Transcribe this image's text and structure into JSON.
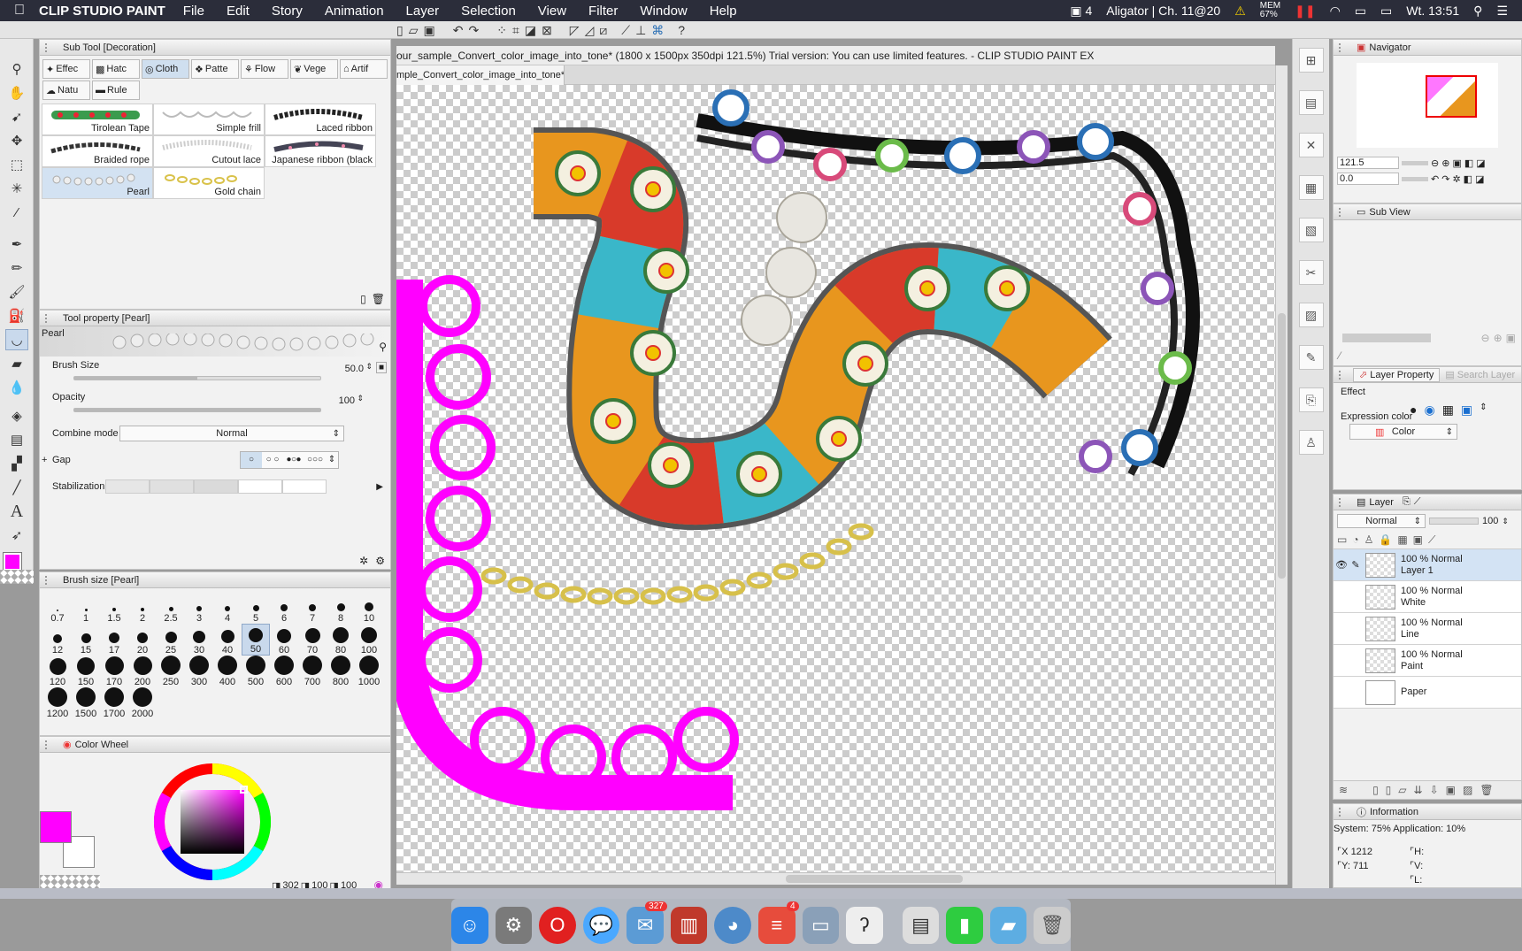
{
  "menubar": {
    "app": "CLIP STUDIO PAINT",
    "items": [
      "File",
      "Edit",
      "Story",
      "Animation",
      "Layer",
      "Selection",
      "View",
      "Filter",
      "Window",
      "Help"
    ],
    "status": {
      "desktop": "4",
      "project": "Aligator | Ch. 11@20",
      "mem": "MEM\n67%",
      "clock": "Wt. 13:51"
    }
  },
  "doc": {
    "title": "our_sample_Convert_color_image_into_tone* (1800 x 1500px 350dpi 121.5%)  Trial version: You can use limited features. - CLIP STUDIO PAINT EX",
    "tab": "mple_Convert_color_image_into_tone*"
  },
  "subtool": {
    "title": "Sub Tool [Decoration]",
    "tabs": [
      "Effec",
      "Hatc",
      "Cloth",
      "Patte",
      "Flow",
      "Vege",
      "Artif",
      "Natu",
      "Rule"
    ],
    "materials": [
      "Tirolean Tape",
      "Simple frill",
      "Laced ribbon",
      "Braided rope",
      "Cutout lace",
      "Japanese ribbon (black",
      "Pearl",
      "Gold chain"
    ]
  },
  "toolprop": {
    "title": "Tool property [Pearl]",
    "name": "Pearl",
    "brush_size_label": "Brush Size",
    "brush_size": "50.0",
    "opacity_label": "Opacity",
    "opacity": "100",
    "combine_label": "Combine mode",
    "combine": "Normal",
    "gap_label": "Gap",
    "stab_label": "Stabilization"
  },
  "brushsize": {
    "title": "Brush size [Pearl]",
    "sizes": [
      "0.7",
      "1",
      "1.5",
      "2",
      "2.5",
      "3",
      "4",
      "5",
      "6",
      "7",
      "8",
      "10",
      "12",
      "15",
      "17",
      "20",
      "25",
      "30",
      "40",
      "50",
      "60",
      "70",
      "80",
      "100",
      "120",
      "150",
      "170",
      "200",
      "250",
      "300",
      "400",
      "500",
      "600",
      "700",
      "800",
      "1000",
      "1200",
      "1500",
      "1700",
      "2000"
    ],
    "selected": "50"
  },
  "colorwheel": {
    "title": "Color Wheel",
    "main_color": "#ff00ff",
    "sub_color": "#ffffff",
    "hsv_h": "302",
    "hsv_s": "100",
    "hsv_v": "100"
  },
  "navigator": {
    "title": "Navigator",
    "zoom": "121.5",
    "rotate": "0.0"
  },
  "subview": {
    "title": "Sub View"
  },
  "layerprop": {
    "title": "Layer Property",
    "search": "Search Layer",
    "effect_label": "Effect",
    "expr_label": "Expression color",
    "expr_value": "Color"
  },
  "layers": {
    "title": "Layer",
    "blend": "Normal",
    "opacity": "100",
    "items": [
      {
        "mode": "100 % Normal",
        "name": "Layer 1"
      },
      {
        "mode": "100 % Normal",
        "name": "White"
      },
      {
        "mode": "100 % Normal",
        "name": "Line"
      },
      {
        "mode": "100 % Normal",
        "name": "Paint"
      },
      {
        "mode": "",
        "name": "Paper"
      }
    ]
  },
  "information": {
    "title": "Information",
    "system": "System: 75% Application: 10%",
    "x_label": "X",
    "x": "1212",
    "y_label": "Y:",
    "y": "711",
    "h_label": "H:",
    "v_label": "V:",
    "l_label": "L:"
  },
  "dock": {
    "badge_mail": "327",
    "badge_tasks": "4"
  },
  "colors": {
    "accent": "#ff00ff",
    "menubar": "#2b2d3a",
    "selection": "#d3e3f4"
  }
}
